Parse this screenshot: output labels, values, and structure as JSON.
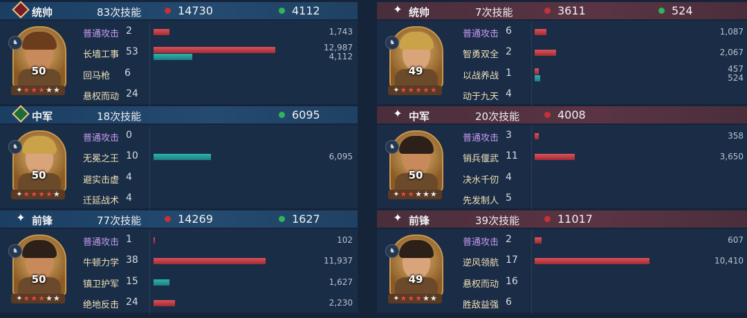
{
  "left": {
    "sections": [
      {
        "role": "统帅",
        "casts": "83次技能",
        "damage": "14730",
        "heal": "4112",
        "level": "50",
        "stars_red": 3,
        "stars_white": 2,
        "skills": [
          {
            "name": "普通攻击",
            "count": "2",
            "basic": true,
            "damage": "1,743",
            "heal": null,
            "dmg_frac": 0.13,
            "heal_frac": 0
          },
          {
            "name": "长墙工事",
            "count": "53",
            "basic": false,
            "damage": "12,987",
            "heal": "4,112",
            "dmg_frac": 0.98,
            "heal_frac": 0.31
          },
          {
            "name": "回马枪",
            "count": "6",
            "basic": false,
            "damage": null,
            "heal": null,
            "dmg_frac": 0,
            "heal_frac": 0
          },
          {
            "name": "悬权而动",
            "count": "24",
            "basic": false,
            "damage": null,
            "heal": null,
            "dmg_frac": 0,
            "heal_frac": 0
          }
        ]
      },
      {
        "role": "中军",
        "casts": "18次技能",
        "damage": null,
        "heal": "6095",
        "level": "50",
        "stars_red": 4,
        "stars_white": 1,
        "skills": [
          {
            "name": "普通攻击",
            "count": "0",
            "basic": true,
            "damage": null,
            "heal": null,
            "dmg_frac": 0,
            "heal_frac": 0
          },
          {
            "name": "无冕之王",
            "count": "10",
            "basic": false,
            "damage": null,
            "heal": "6,095",
            "dmg_frac": 0,
            "heal_frac": 0.46
          },
          {
            "name": "避实击虚",
            "count": "4",
            "basic": false,
            "damage": null,
            "heal": null,
            "dmg_frac": 0,
            "heal_frac": 0
          },
          {
            "name": "迁延战术",
            "count": "4",
            "basic": false,
            "damage": null,
            "heal": null,
            "dmg_frac": 0,
            "heal_frac": 0
          }
        ]
      },
      {
        "role": "前锋",
        "casts": "77次技能",
        "damage": "14269",
        "heal": "1627",
        "level": "50",
        "stars_red": 3,
        "stars_white": 2,
        "skills": [
          {
            "name": "普通攻击",
            "count": "1",
            "basic": true,
            "damage": "102",
            "heal": null,
            "dmg_frac": 0.01,
            "heal_frac": 0
          },
          {
            "name": "牛顿力学",
            "count": "38",
            "basic": false,
            "damage": "11,937",
            "heal": null,
            "dmg_frac": 0.9,
            "heal_frac": 0
          },
          {
            "name": "镇卫护军",
            "count": "15",
            "basic": false,
            "damage": null,
            "heal": "1,627",
            "dmg_frac": 0,
            "heal_frac": 0.13
          },
          {
            "name": "绝地反击",
            "count": "24",
            "basic": false,
            "damage": "2,230",
            "heal": null,
            "dmg_frac": 0.17,
            "heal_frac": 0
          }
        ]
      }
    ]
  },
  "right": {
    "sections": [
      {
        "role": "统帅",
        "casts": "7次技能",
        "damage": "3611",
        "heal": "524",
        "level": "49",
        "stars_red": 5,
        "stars_white": 0,
        "skills": [
          {
            "name": "普通攻击",
            "count": "6",
            "basic": true,
            "damage": "1,087",
            "heal": null,
            "dmg_frac": 0.08,
            "heal_frac": 0
          },
          {
            "name": "智勇双全",
            "count": "2",
            "basic": false,
            "damage": "2,067",
            "heal": null,
            "dmg_frac": 0.15,
            "heal_frac": 0
          },
          {
            "name": "以战养战",
            "count": "1",
            "basic": false,
            "damage": "457",
            "heal": "524",
            "dmg_frac": 0.03,
            "heal_frac": 0.04
          },
          {
            "name": "动于九天",
            "count": "4",
            "basic": false,
            "damage": null,
            "heal": null,
            "dmg_frac": 0,
            "heal_frac": 0
          }
        ]
      },
      {
        "role": "中军",
        "casts": "20次技能",
        "damage": "4008",
        "heal": null,
        "level": "50",
        "stars_red": 2,
        "stars_white": 3,
        "skills": [
          {
            "name": "普通攻击",
            "count": "3",
            "basic": true,
            "damage": "358",
            "heal": null,
            "dmg_frac": 0.03,
            "heal_frac": 0
          },
          {
            "name": "销兵偃武",
            "count": "11",
            "basic": false,
            "damage": "3,650",
            "heal": null,
            "dmg_frac": 0.28,
            "heal_frac": 0
          },
          {
            "name": "决水千仞",
            "count": "4",
            "basic": false,
            "damage": null,
            "heal": null,
            "dmg_frac": 0,
            "heal_frac": 0
          },
          {
            "name": "先发制人",
            "count": "5",
            "basic": false,
            "damage": null,
            "heal": null,
            "dmg_frac": 0,
            "heal_frac": 0
          }
        ]
      },
      {
        "role": "前锋",
        "casts": "39次技能",
        "damage": "11017",
        "heal": null,
        "level": "49",
        "stars_red": 3,
        "stars_white": 2,
        "skills": [
          {
            "name": "普通攻击",
            "count": "2",
            "basic": true,
            "damage": "607",
            "heal": null,
            "dmg_frac": 0.05,
            "heal_frac": 0
          },
          {
            "name": "逆风领航",
            "count": "17",
            "basic": false,
            "damage": "10,410",
            "heal": null,
            "dmg_frac": 0.8,
            "heal_frac": 0
          },
          {
            "name": "悬权而动",
            "count": "16",
            "basic": false,
            "damage": null,
            "heal": null,
            "dmg_frac": 0,
            "heal_frac": 0
          },
          {
            "name": "胜敌益强",
            "count": "6",
            "basic": false,
            "damage": null,
            "heal": null,
            "dmg_frac": 0,
            "heal_frac": 0
          }
        ]
      }
    ]
  },
  "colors": {
    "damage": "#c43237",
    "heal": "#2fb55a",
    "bar_damage": "#c7434b",
    "bar_heal": "#22a0a0",
    "basic_skill": "#c89cf0"
  },
  "icons": {
    "commander_badge": "sword-emblem-icon",
    "center_badge": "heart-emblem-icon",
    "vanguard_badge": "four-point-star-icon",
    "troop_type": "cavalry-icon"
  }
}
